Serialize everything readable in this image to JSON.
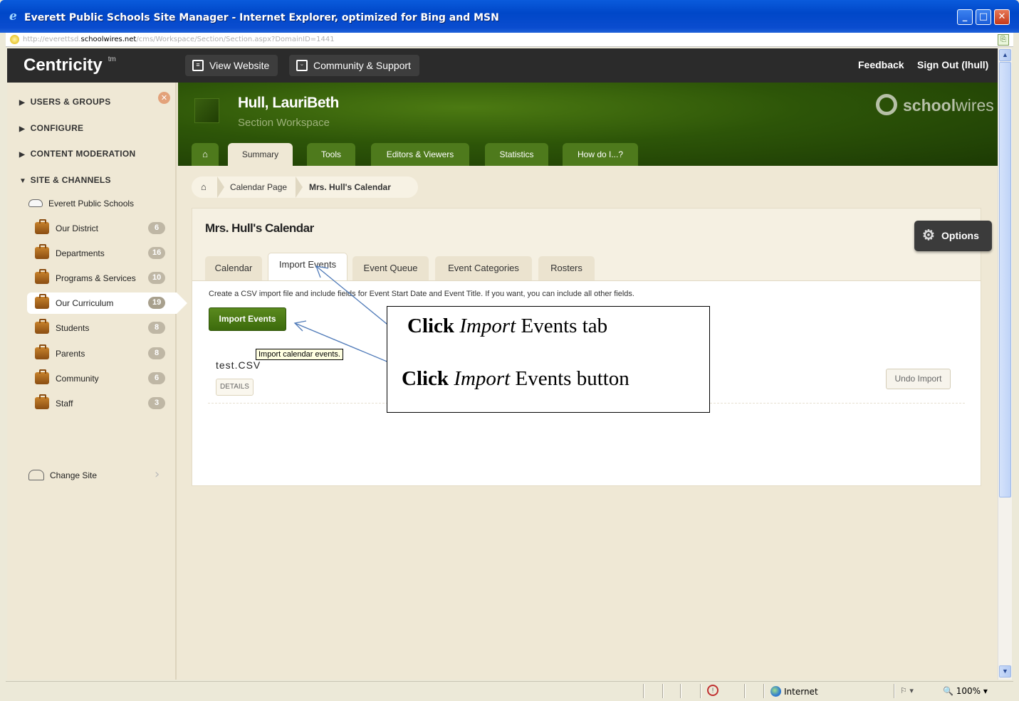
{
  "window": {
    "title": "Everett Public Schools Site Manager - Internet Explorer, optimized for Bing and MSN",
    "url_prefix": "http://everettsd.",
    "url_domain": "schoolwires.net",
    "url_path": "/cms/Workspace/Section/Section.aspx?DomainID=1441",
    "minimize": "_",
    "maximize": "□",
    "close": "✕"
  },
  "topbar": {
    "brand": "Centricity",
    "brand_tm": "tm",
    "view_website": "View Website",
    "community_support": "Community & Support",
    "feedback": "Feedback",
    "sign_out": "Sign Out (lhull)"
  },
  "sidebar": {
    "close_glyph": "✕",
    "sections": [
      {
        "label": "USERS & GROUPS",
        "arrow": "▶"
      },
      {
        "label": "CONFIGURE",
        "arrow": "▶"
      },
      {
        "label": "CONTENT MODERATION",
        "arrow": "▶"
      },
      {
        "label": "SITE & CHANNELS",
        "arrow": "▼"
      }
    ],
    "site_root": "Everett Public Schools",
    "channels": [
      {
        "label": "Our District",
        "count": "6"
      },
      {
        "label": "Departments",
        "count": "16"
      },
      {
        "label": "Programs & Services",
        "count": "10"
      },
      {
        "label": "Our Curriculum",
        "count": "19"
      },
      {
        "label": "Students",
        "count": "8"
      },
      {
        "label": "Parents",
        "count": "8"
      },
      {
        "label": "Community",
        "count": "6"
      },
      {
        "label": "Staff",
        "count": "3"
      }
    ],
    "active_channel": "Our Curriculum",
    "change_site": "Change Site",
    "change_site_chevron": "›"
  },
  "header": {
    "user_name": "Hull, LauriBeth",
    "workspace_label": "Section Workspace",
    "logo_bold": "school",
    "logo_light": "wires",
    "tabs": [
      "Summary",
      "Tools",
      "Editors & Viewers",
      "Statistics",
      "How do I...?"
    ],
    "active_tab": "Summary",
    "home_glyph": "⌂"
  },
  "breadcrumb": {
    "home_glyph": "⌂",
    "items": [
      "Calendar Page",
      "Mrs. Hull's Calendar"
    ]
  },
  "panel": {
    "title": "Mrs. Hull's Calendar",
    "tabs": [
      "Calendar",
      "Import Events",
      "Event Queue",
      "Event Categories",
      "Rosters"
    ],
    "active_tab": "Import Events",
    "instructions": "Create a CSV import file and include fields for Event Start Date and Event Title. If you want, you can include all other fields.",
    "import_button": "Import Events",
    "tooltip": "Import calendar events.",
    "file_name": "test.CSV",
    "details_button": "DETAILS",
    "undo_button": "Undo Import"
  },
  "options": {
    "label": "Options",
    "gear": "⚙"
  },
  "annotation": {
    "line1_bold": "Click",
    "line1_italic": "Import",
    "line1_rest": "Events tab",
    "line2_bold": "Click",
    "line2_italic": "Import",
    "line2_rest": "Events button"
  },
  "statusbar": {
    "zone": "Internet",
    "zoom": "100%",
    "dropdown": "▾"
  },
  "colors": {
    "topbar": "#2b2b2b",
    "banner_green": "#2d5508",
    "import_button": "#4a7a14",
    "sidebar_bg": "#efe8d5",
    "arrow": "#4f7ab8"
  }
}
